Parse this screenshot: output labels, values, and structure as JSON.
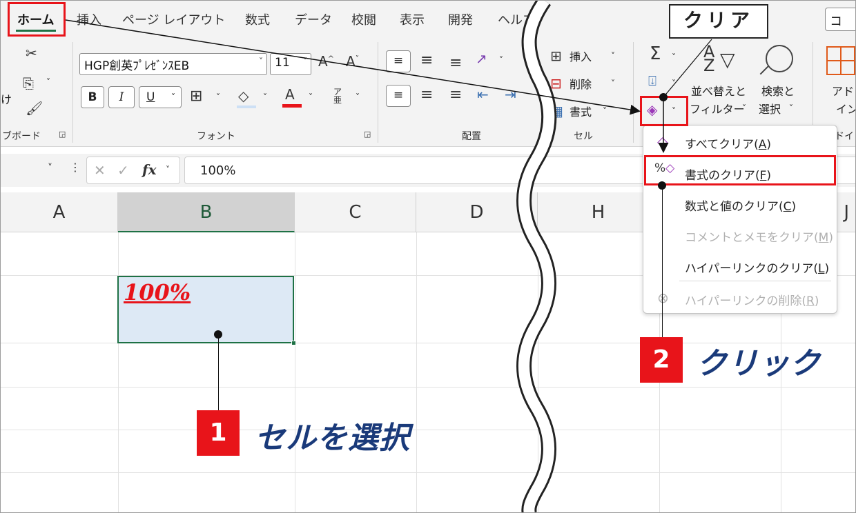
{
  "ribbon": {
    "tabs": [
      {
        "label": "ホーム",
        "active": true
      },
      {
        "label": "挿入"
      },
      {
        "label": "ページ レイアウト"
      },
      {
        "label": "数式"
      },
      {
        "label": "データ"
      },
      {
        "label": "校閲"
      },
      {
        "label": "表示"
      },
      {
        "label": "開発"
      },
      {
        "label": "ヘルプ"
      }
    ],
    "right_tab_partial": "コ",
    "clipboard": {
      "paste_partial": "け",
      "label": "ブボード"
    },
    "font": {
      "name": "HGP創英ﾌﾟﾚｾﾞﾝｽEB",
      "size": "11",
      "bold": "B",
      "italic": "I",
      "underline": "U",
      "grow": "A^",
      "shrink": "A˅",
      "color_letter": "A",
      "furigana": "ア亜",
      "label": "フォント"
    },
    "alignment": {
      "label": "配置"
    },
    "cells": {
      "insert": "挿入",
      "delete": "削除",
      "format": "書式",
      "label": "セル"
    },
    "editing": {
      "sort_filter_line1": "並べ替えと",
      "sort_filter_line2": "フィルター",
      "find_select_line1": "検索と",
      "find_select_line2": "選択",
      "sum_icon": "Σ",
      "clear_icon": "eraser-icon"
    },
    "addins": {
      "line1": "アド",
      "line2": "イン",
      "partial_label": "ドイン"
    }
  },
  "formula_bar": {
    "value": "100%",
    "fx": "fx"
  },
  "sheet": {
    "columns": [
      "A",
      "B",
      "C",
      "D",
      "H",
      "J"
    ],
    "selected_cell": {
      "column": "B",
      "value": "100%"
    }
  },
  "clear_menu": {
    "items": [
      {
        "label": "すべてクリア(",
        "key": "A",
        "suffix": ")",
        "enabled": true
      },
      {
        "label": "書式のクリア(",
        "key": "F",
        "suffix": ")",
        "enabled": true,
        "highlighted": true
      },
      {
        "label": "数式と値のクリア(",
        "key": "C",
        "suffix": ")",
        "enabled": true
      },
      {
        "label": "コメントとメモをクリア(",
        "key": "M",
        "suffix": ")",
        "enabled": false
      },
      {
        "label": "ハイパーリンクのクリア(",
        "key": "L",
        "suffix": ")",
        "enabled": true
      },
      {
        "label": "ハイパーリンクの削除(",
        "key": "R",
        "suffix": ")",
        "enabled": false
      }
    ]
  },
  "annotations": {
    "callout": "クリア",
    "step1": {
      "num": "1",
      "text": "セルを選択"
    },
    "step2": {
      "num": "2",
      "text": "クリック"
    }
  },
  "colors": {
    "accent_green": "#1e7145",
    "annotation_red": "#e8141a",
    "step_text": "#1a3a7a",
    "cell_value": "#e8141a"
  }
}
